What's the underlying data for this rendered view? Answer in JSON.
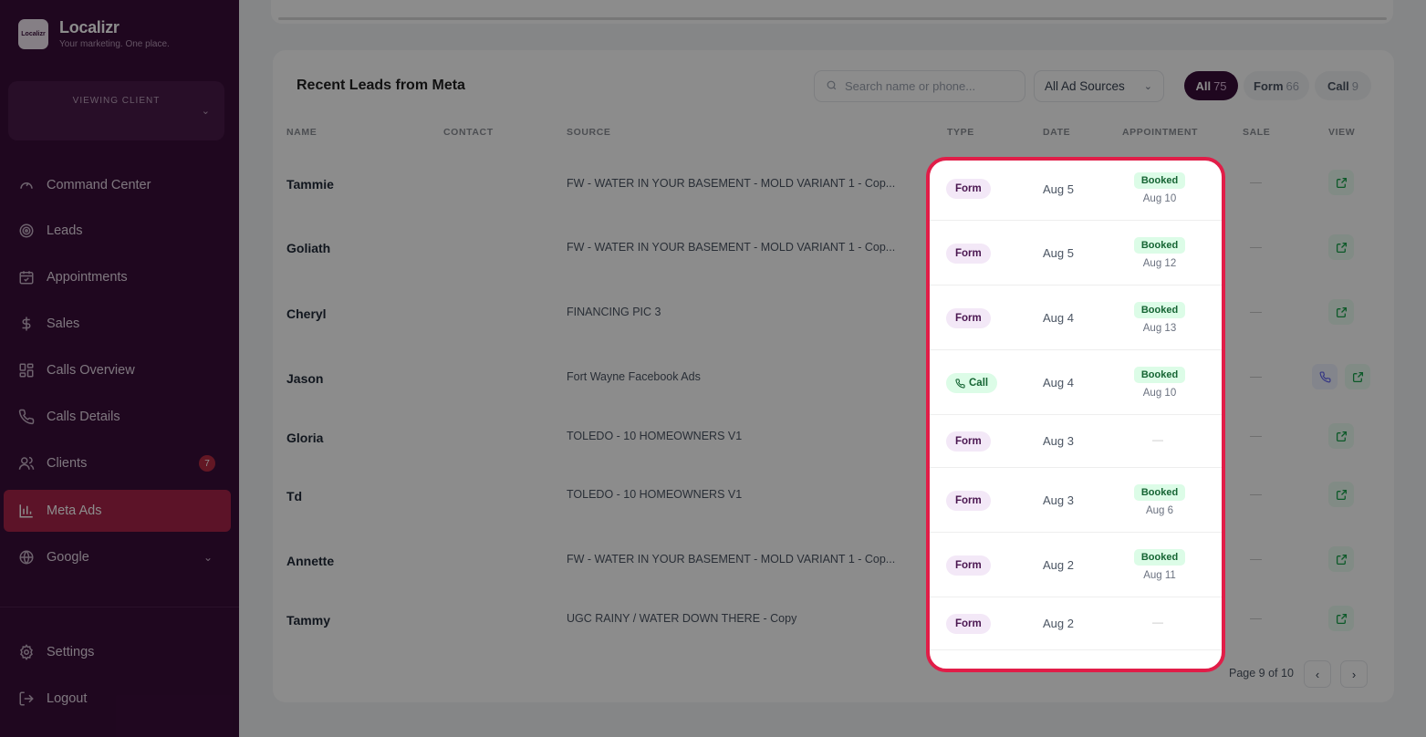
{
  "brand": {
    "name": "Localizr",
    "tagline": "Your marketing. One place.",
    "logo_text": "Localizr"
  },
  "client_selector": {
    "label": "VIEWING CLIENT"
  },
  "nav": {
    "items": [
      {
        "label": "Command Center",
        "icon": "gauge-icon"
      },
      {
        "label": "Leads",
        "icon": "target-icon"
      },
      {
        "label": "Appointments",
        "icon": "calendar-icon"
      },
      {
        "label": "Sales",
        "icon": "dollar-icon"
      },
      {
        "label": "Calls Overview",
        "icon": "grid-icon"
      },
      {
        "label": "Calls Details",
        "icon": "phone-icon"
      },
      {
        "label": "Clients",
        "icon": "users-icon",
        "badge": "7"
      },
      {
        "label": "Meta Ads",
        "icon": "bar-chart-icon",
        "active": true
      },
      {
        "label": "Google",
        "icon": "globe-icon"
      }
    ],
    "settings": "Settings",
    "logout": "Logout"
  },
  "leads": {
    "title": "Recent Leads from Meta",
    "search_placeholder": "Search name or phone...",
    "source_filter": "All Ad Sources",
    "filters": [
      {
        "label": "All",
        "count": "75",
        "active": true
      },
      {
        "label": "Form",
        "count": "66"
      },
      {
        "label": "Call",
        "count": "9"
      }
    ],
    "columns": [
      "NAME",
      "CONTACT",
      "SOURCE",
      "TYPE",
      "DATE",
      "APPOINTMENT",
      "SALE",
      "VIEW"
    ],
    "rows": [
      {
        "name": "Tammie",
        "source": "FW - WATER IN YOUR BASEMENT - MOLD VARIANT 1 - Cop...",
        "type": "Form",
        "date": "Aug 5",
        "appt_status": "Booked",
        "appt_date": "Aug 10",
        "sale": "—"
      },
      {
        "name": "Goliath",
        "source": "FW - WATER IN YOUR BASEMENT - MOLD VARIANT 1 - Cop...",
        "type": "Form",
        "date": "Aug 5",
        "appt_status": "Booked",
        "appt_date": "Aug 12",
        "sale": "—"
      },
      {
        "name": "Cheryl",
        "source": "FINANCING PIC 3",
        "type": "Form",
        "date": "Aug 4",
        "appt_status": "Booked",
        "appt_date": "Aug 13",
        "sale": "—"
      },
      {
        "name": "Jason",
        "source": "Fort Wayne Facebook Ads",
        "type": "Call",
        "date": "Aug 4",
        "appt_status": "Booked",
        "appt_date": "Aug 10",
        "sale": "—"
      },
      {
        "name": "Gloria",
        "source": "TOLEDO - 10 HOMEOWNERS V1",
        "type": "Form",
        "date": "Aug 3",
        "appt_status": "—",
        "appt_date": "",
        "sale": "—"
      },
      {
        "name": "Td",
        "source": "TOLEDO - 10 HOMEOWNERS V1",
        "type": "Form",
        "date": "Aug 3",
        "appt_status": "Booked",
        "appt_date": "Aug 6",
        "sale": "—"
      },
      {
        "name": "Annette",
        "source": "FW - WATER IN YOUR BASEMENT - MOLD VARIANT 1 - Cop...",
        "type": "Form",
        "date": "Aug 2",
        "appt_status": "Booked",
        "appt_date": "Aug 11",
        "sale": "—"
      },
      {
        "name": "Tammy",
        "source": "UGC RAINY / WATER DOWN THERE - Copy",
        "type": "Form",
        "date": "Aug 2",
        "appt_status": "—",
        "appt_date": "",
        "sale": "—"
      }
    ],
    "pagination": {
      "label": "Page 9 of 10",
      "prev": "‹",
      "next": "›"
    }
  },
  "colors": {
    "sidebar": "#3a0d3a",
    "active_nav": "#a8234a",
    "highlight_border": "#e11d48",
    "booked_bg": "#dcfce7"
  }
}
